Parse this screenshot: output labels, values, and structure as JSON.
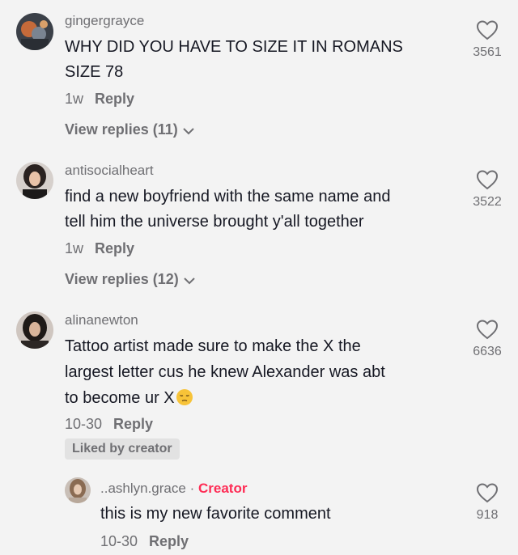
{
  "comments": [
    {
      "username": "gingergrayce",
      "text_lines": [
        "WHY DID YOU HAVE TO SIZE IT IN ROMANS",
        "SIZE 78"
      ],
      "time": "1w",
      "reply_label": "Reply",
      "view_replies": "View replies (11)",
      "likes": "3561",
      "avatar_icon": "user-avatar"
    },
    {
      "username": "antisocialheart",
      "text_lines": [
        "find a new boyfriend with the same name and",
        "tell him the universe brought y'all together"
      ],
      "time": "1w",
      "reply_label": "Reply",
      "view_replies": "View replies (12)",
      "likes": "3522",
      "avatar_icon": "user-avatar"
    },
    {
      "username": "alinanewton",
      "text_lines": [
        "Tattoo artist made sure to make the X the",
        "largest letter cus he knew Alexander was abt",
        "to become ur X"
      ],
      "emoji": "pensive-face-emoji",
      "time": "10-30",
      "reply_label": "Reply",
      "liked_badge": "Liked by creator",
      "likes": "6636",
      "avatar_icon": "user-avatar"
    }
  ],
  "reply": {
    "username": "..ashlyn.grace",
    "separator": "·",
    "creator_label": "Creator",
    "text": "this is my new favorite comment",
    "time": "10-30",
    "reply_label": "Reply",
    "likes": "918",
    "avatar_icon": "user-avatar"
  },
  "colors": {
    "background": "#f3f3f3",
    "text": "#161823",
    "secondary": "#6f6f73",
    "creator_accent": "#fe2c55"
  },
  "icons": {
    "like": "heart-outline-icon",
    "expand": "chevron-down-icon"
  }
}
